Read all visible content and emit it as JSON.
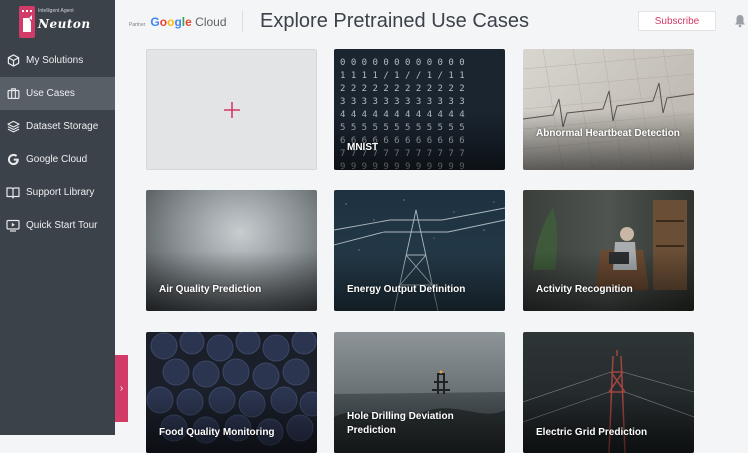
{
  "sidebar": {
    "logo_small": "Intelligent Agent",
    "logo_brand": "Neuton",
    "items": [
      {
        "label": "My Solutions",
        "icon": "cube-icon"
      },
      {
        "label": "Use Cases",
        "icon": "briefcase-icon"
      },
      {
        "label": "Dataset Storage",
        "icon": "layers-icon"
      },
      {
        "label": "Google Cloud",
        "icon": "google-icon"
      },
      {
        "label": "Support Library",
        "icon": "book-icon"
      },
      {
        "label": "Quick Start Tour",
        "icon": "play-screen-icon"
      }
    ],
    "active_item": "Use Cases",
    "expander_glyph": "›"
  },
  "header": {
    "partner_label": "Partner",
    "partner_name": "Google Cloud",
    "title": "Explore Pretrained Use Cases",
    "subscribe_label": "Subscribe",
    "bell_icon": "bell-icon"
  },
  "cards": [
    {
      "label": "",
      "type": "add",
      "icon": "plus-icon"
    },
    {
      "label": "MNIST"
    },
    {
      "label": "Abnormal Heartbeat Detection"
    },
    {
      "label": "Air Quality Prediction"
    },
    {
      "label": "Energy Output Definition"
    },
    {
      "label": "Activity Recognition"
    },
    {
      "label": "Food Quality Monitoring"
    },
    {
      "label": "Hole Drilling Deviation Prediction"
    },
    {
      "label": "Electric Grid Prediction"
    }
  ],
  "colors": {
    "accent": "#d23a67",
    "sidebar_bg": "#3c4249",
    "sidebar_active": "#585f67",
    "page_bg": "#f4f5f7"
  }
}
